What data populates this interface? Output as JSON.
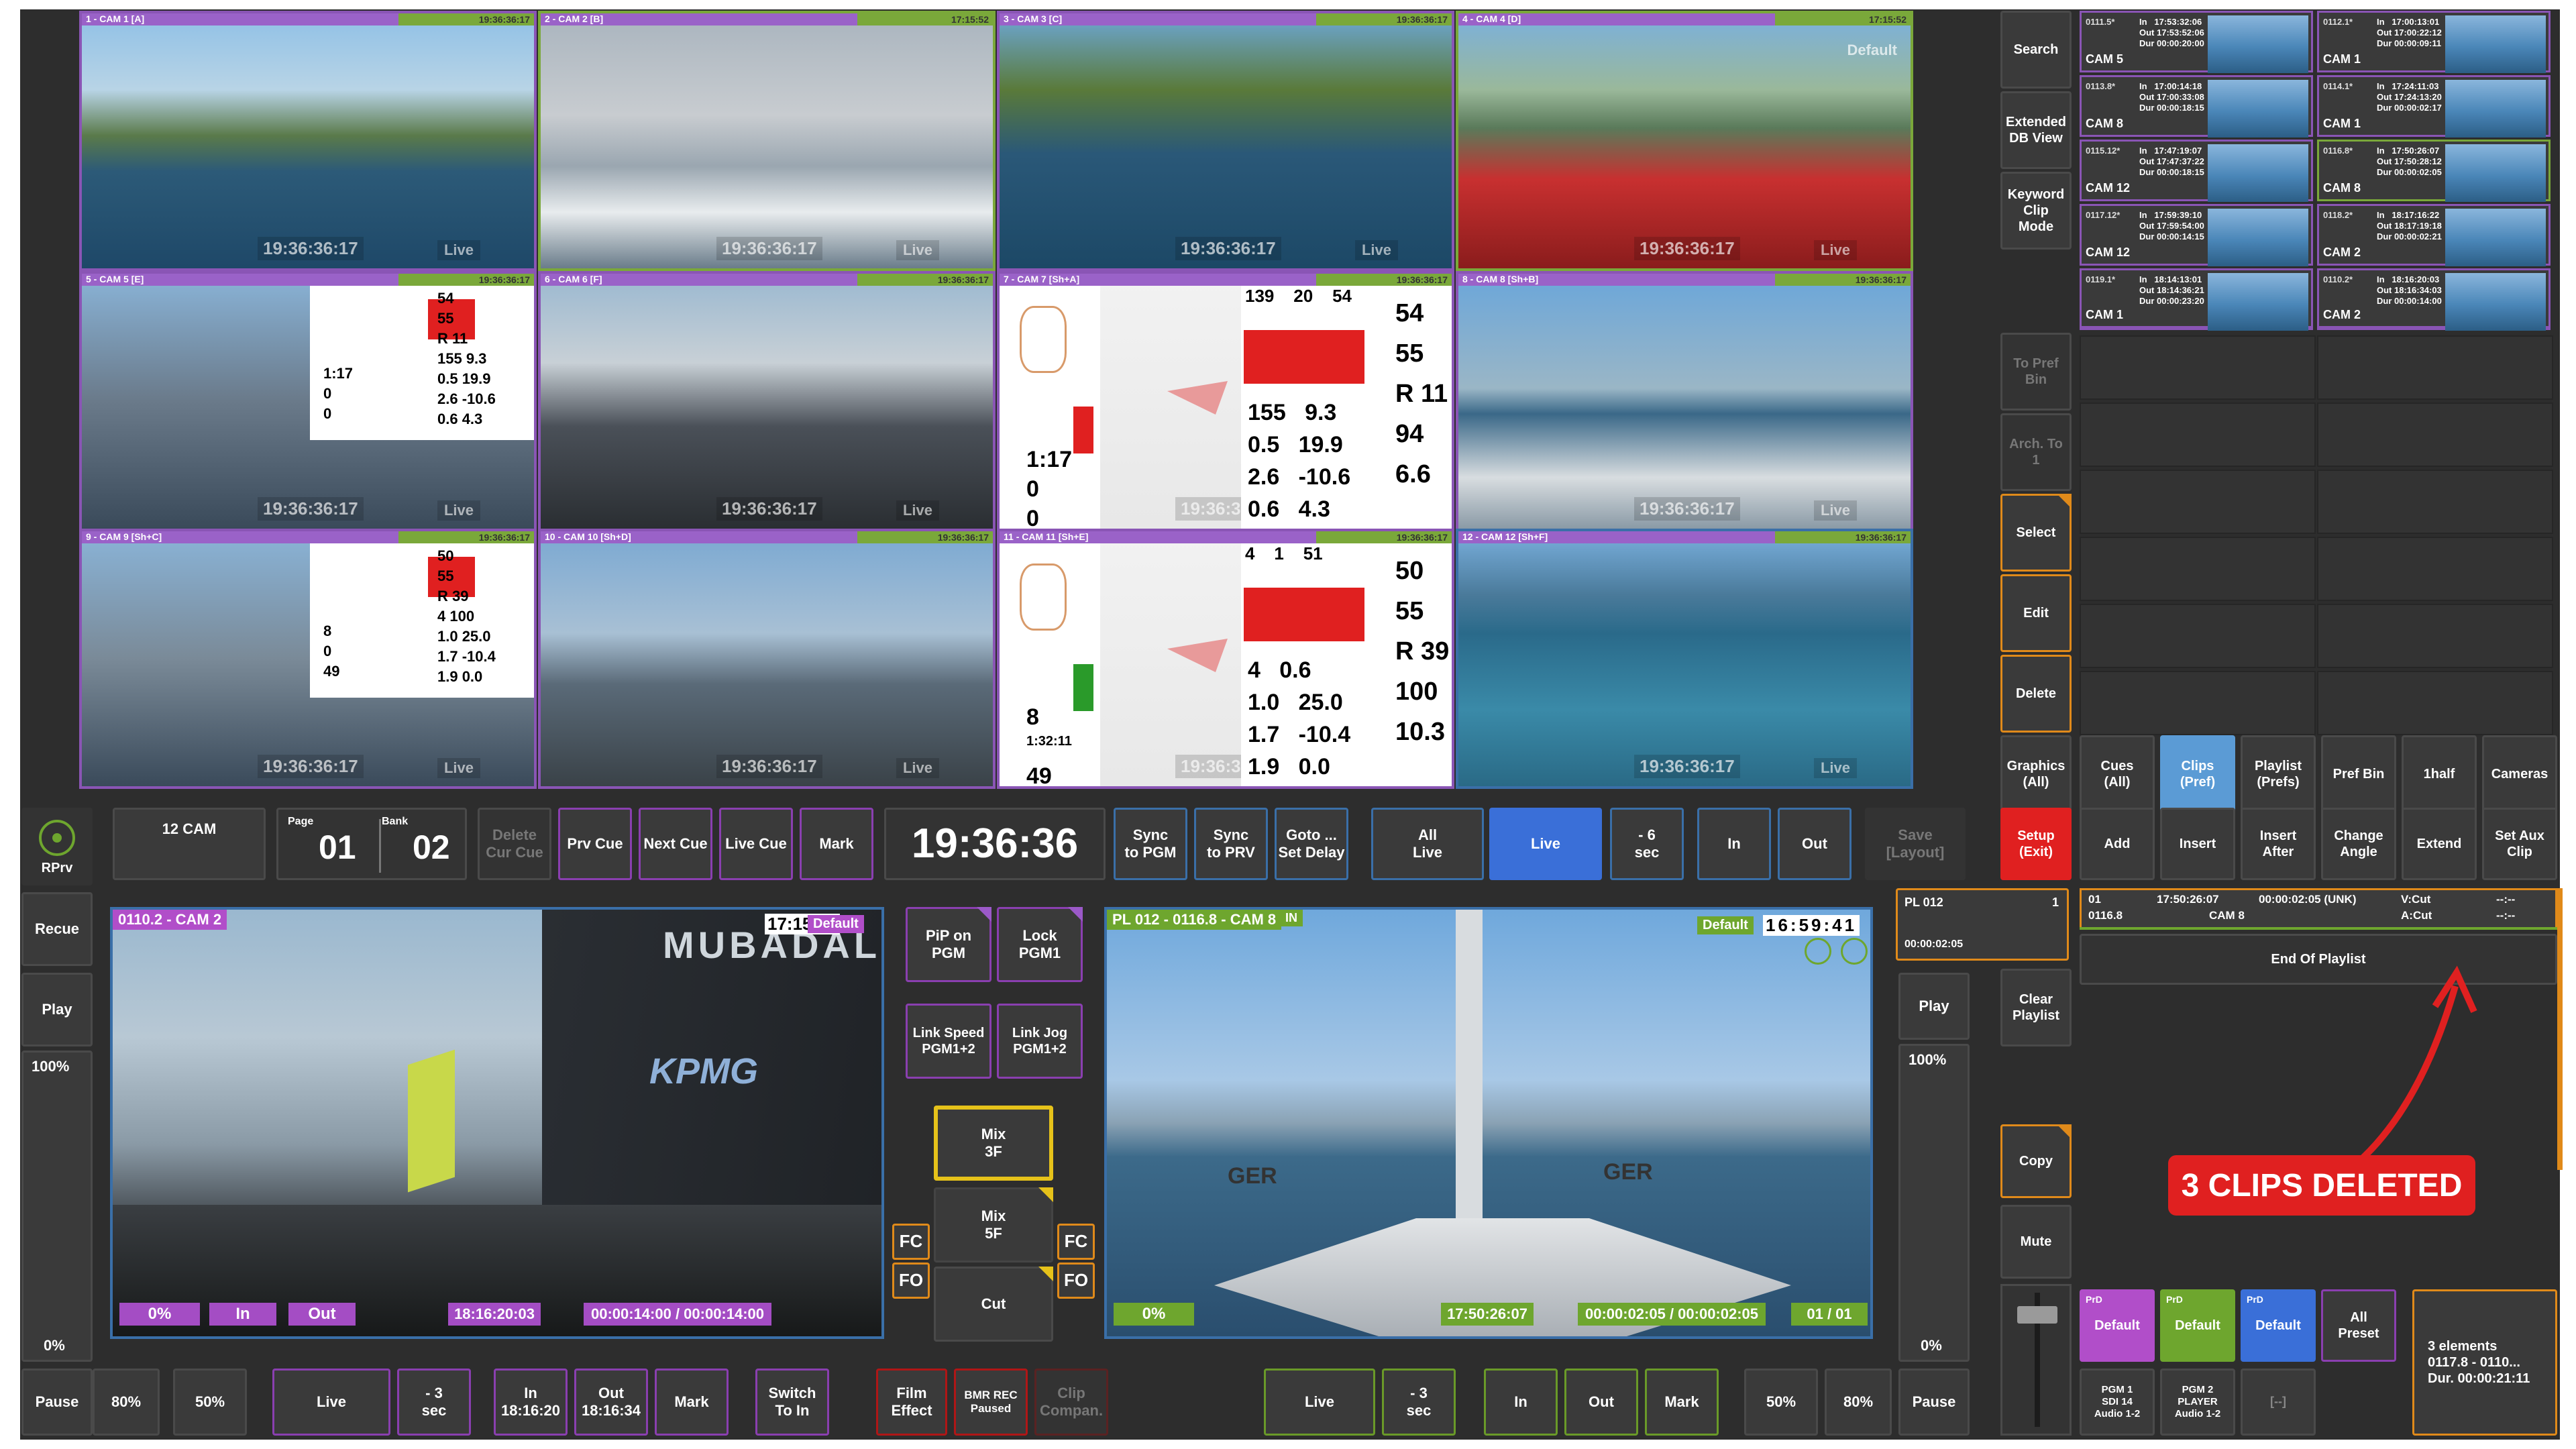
{
  "tiles": [
    {
      "label": "1 - CAM 1 [A]",
      "tc": "19:36:36:17",
      "time": "19:36:36:17",
      "live": "Live",
      "default": ""
    },
    {
      "label": "2 - CAM 2 [B]",
      "tc": "17:15:52",
      "time": "19:36:36:17",
      "live": "Live",
      "default": ""
    },
    {
      "label": "3 - CAM 3 [C]",
      "tc": "19:36:36:17",
      "time": "19:36:36:17",
      "live": "Live",
      "default": ""
    },
    {
      "label": "4 - CAM 4 [D]",
      "tc": "17:15:52",
      "time": "19:36:36:17",
      "live": "Live",
      "default": "Default"
    },
    {
      "label": "5 - CAM 5 [E]",
      "tc": "19:36:36:17",
      "time": "19:36:36:17",
      "live": "Live",
      "default": ""
    },
    {
      "label": "6 - CAM 6 [F]",
      "tc": "19:36:36:17",
      "time": "19:36:36:17",
      "live": "Live",
      "default": ""
    },
    {
      "label": "7 - CAM 7 [Sh+A]",
      "tc": "19:36:36:17",
      "time": "19:36:36:17",
      "live": "Live",
      "default": ""
    },
    {
      "label": "8 - CAM 8 [Sh+B]",
      "tc": "19:36:36:17",
      "time": "19:36:36:17",
      "live": "Live",
      "default": ""
    },
    {
      "label": "9 - CAM 9 [Sh+C]",
      "tc": "19:36:36:17",
      "time": "19:36:36:17",
      "live": "Live",
      "default": ""
    },
    {
      "label": "10 - CAM 10 [Sh+D]",
      "tc": "19:36:36:17",
      "time": "19:36:36:17",
      "live": "Live",
      "default": ""
    },
    {
      "label": "11 - CAM 11 [Sh+E]",
      "tc": "19:36:36:17",
      "time": "19:36:36:17",
      "live": "Live",
      "default": ""
    },
    {
      "label": "12 - CAM 12 [Sh+F]",
      "tc": "19:36:36:17",
      "time": "19:36:36:17",
      "live": "Live",
      "default": ""
    }
  ],
  "telemetry": {
    "tile7": {
      "top": [
        "139",
        "20",
        "54"
      ],
      "rows": [
        [
          "155",
          "9.3"
        ],
        [
          "0.5",
          "19.9"
        ],
        [
          "2.6",
          "-10.6"
        ],
        [
          "0.6",
          "4.3"
        ]
      ],
      "right": [
        "54",
        "55",
        "R 11",
        "94",
        "6.6"
      ],
      "left": [
        "1:17",
        "0",
        "0"
      ]
    },
    "tile11": {
      "top": [
        "4",
        "1",
        "51"
      ],
      "rows": [
        [
          "4",
          "0.6"
        ],
        [
          "1.0",
          "25.0"
        ],
        [
          "1.7",
          "-10.4"
        ],
        [
          "1.9",
          "0.0"
        ]
      ],
      "right": [
        "50",
        "55",
        "R 39",
        "100",
        "10.3"
      ],
      "left": [
        "8",
        "1:32:11",
        "49"
      ]
    },
    "tile5": {
      "rows": [
        "54",
        "55",
        "R 11",
        "155 9.3",
        "0.5 19.9",
        "2.6 -10.6",
        "0.6 4.3"
      ],
      "left": [
        "1:17",
        "0",
        "0"
      ]
    },
    "tile9": {
      "rows": [
        "50",
        "55",
        "R 39",
        "4 100",
        "1.0 25.0",
        "1.7 -10.4",
        "1.9 0.0"
      ],
      "left": [
        "8",
        "0",
        "49"
      ]
    }
  },
  "side_buttons": {
    "search": "Search",
    "extended": "Extended\nDB View",
    "keyword": "Keyword\nClip\nMode",
    "to_pref_bin": "To Pref\nBin",
    "arch_to": "Arch. To\n1",
    "select": "Select",
    "edit": "Edit",
    "delete": "Delete",
    "graphics": "Graphics\n(All)"
  },
  "clips": [
    {
      "id": "0111.5*",
      "in": "17:53:32:06",
      "out": "17:53:52:06",
      "dur": "00:00:20:00",
      "cam": "CAM 5"
    },
    {
      "id": "0112.1*",
      "in": "17:00:13:01",
      "out": "17:00:22:12",
      "dur": "00:00:09:11",
      "cam": "CAM 1"
    },
    {
      "id": "0113.8*",
      "in": "17:00:14:18",
      "out": "17:00:33:08",
      "dur": "00:00:18:15",
      "cam": "CAM 8"
    },
    {
      "id": "0114.1*",
      "in": "17:24:11:03",
      "out": "17:24:13:20",
      "dur": "00:00:02:17",
      "cam": "CAM 1"
    },
    {
      "id": "0115.12*",
      "in": "17:47:19:07",
      "out": "17:47:37:22",
      "dur": "00:00:18:15",
      "cam": "CAM 12"
    },
    {
      "id": "0116.8*",
      "in": "17:50:26:07",
      "out": "17:50:28:12",
      "dur": "00:00:02:05",
      "cam": "CAM 8"
    },
    {
      "id": "0117.12*",
      "in": "17:59:39:10",
      "out": "17:59:54:00",
      "dur": "00:00:14:15",
      "cam": "CAM 12"
    },
    {
      "id": "0118.2*",
      "in": "18:17:16:22",
      "out": "18:17:19:18",
      "dur": "00:00:02:21",
      "cam": "CAM 2"
    },
    {
      "id": "0119.1*",
      "in": "18:14:13:01",
      "out": "18:14:36:21",
      "dur": "00:00:23:20",
      "cam": "CAM 1"
    },
    {
      "id": "0110.2*",
      "in": "18:16:20:03",
      "out": "18:16:34:03",
      "dur": "00:00:14:00",
      "cam": "CAM 2"
    }
  ],
  "clip_labels": {
    "in": "In",
    "out": "Out",
    "dur": "Dur"
  },
  "tabs": {
    "cues": "Cues\n(All)",
    "clips": "Clips\n(Pref)",
    "playlist": "Playlist\n(Prefs)",
    "pref_bin": "Pref Bin",
    "half": "1half",
    "cameras": "Cameras"
  },
  "controls": {
    "rprv": "RPrv",
    "cam12": "12 CAM",
    "page_label": "Page",
    "page": "01",
    "bank_label": "Bank",
    "bank": "02",
    "delete_cue": "Delete\nCur Cue",
    "prv_cue": "Prv Cue",
    "next_cue": "Next Cue",
    "live_cue": "Live Cue",
    "mark": "Mark",
    "clock": "19:36:36",
    "sync_pgm": "Sync\nto PGM",
    "sync_prv": "Sync\nto PRV",
    "goto": "Goto ...\nSet Delay",
    "all_live": "All\nLive",
    "live": "Live",
    "minus6": "- 6\nsec",
    "in": "In",
    "out": "Out",
    "save_layout": "Save\n[Layout]",
    "setup": "Setup\n(Exit)",
    "add": "Add",
    "insert": "Insert",
    "insert_after": "Insert\nAfter",
    "change_angle": "Change\nAngle",
    "extend": "Extend",
    "set_aux": "Set Aux\nClip"
  },
  "left_monitor": {
    "title": "0110.2 - CAM 2",
    "tc": "17:15:52",
    "default": "Default",
    "pct": "0%",
    "in": "In",
    "out": "Out",
    "time": "18:16:20:03",
    "range": "00:00:14:00 / 00:00:14:00",
    "watermark": "MUBADALA",
    "kpmg": "KPMG"
  },
  "right_monitor": {
    "title": "PL 012 - 0116.8 - CAM 8",
    "in_tag": "IN",
    "tc": "16:59:41",
    "default": "Default",
    "pct": "0%",
    "time": "17:50:26:07",
    "range": "00:00:02:05 / 00:00:02:05",
    "count": "01 / 01",
    "sail1": "GER",
    "sail2": "GER"
  },
  "left_rail": {
    "recue": "Recue",
    "play": "Play",
    "pct_top": "100%",
    "pct_bottom": "0%",
    "pause": "Pause"
  },
  "center": {
    "pip": "PiP on\nPGM",
    "lock": "Lock\nPGM1",
    "link_speed": "Link Speed\nPGM1+2",
    "link_jog": "Link Jog\nPGM1+2",
    "mix3": "Mix\n3F",
    "mix5": "Mix\n5F",
    "cut": "Cut",
    "fc": "FC",
    "fo": "FO"
  },
  "playlist": {
    "name": "PL 012",
    "num": "1",
    "dur": "00:00:02:05",
    "row_idx": "01",
    "row_in": "17:50:26:07",
    "row_dur": "00:00:02:05 (UNK)",
    "row_clip": "0116.8",
    "row_cam": "CAM 8",
    "vcut": "V:Cut",
    "acut": "A:Cut",
    "dash1": "--:--",
    "dash2": "--:--",
    "end": "End Of Playlist",
    "clear": "Clear\nPlaylist",
    "play": "Play",
    "pct_top": "100%",
    "pct_bottom": "0%",
    "copy": "Copy",
    "mute": "Mute"
  },
  "annotation": "3 CLIPS DELETED",
  "presets": {
    "p1": "Default",
    "p2": "Default",
    "p3": "Default",
    "all": "All\nPreset",
    "prd": "PrD",
    "info": "3 elements\n0117.8 - 0110...\nDur. 00:00:21:11",
    "out1": "PGM 1\nSDI 14\nAudio 1-2",
    "out2": "PGM 2\nPLAYER\nAudio 1-2",
    "out3": "[--]"
  },
  "bottom": {
    "pause": "Pause",
    "p80": "80%",
    "p50": "50%",
    "live": "Live",
    "minus3": "- 3\nsec",
    "in": "In\n18:16:20",
    "out": "Out\n18:16:34",
    "mark": "Mark",
    "switch": "Switch\nTo In",
    "film": "Film\nEffect",
    "bmr": "BMR REC\nPaused",
    "clip_comp": "Clip\nCompan.",
    "r_live": "Live",
    "r_minus3": "- 3\nsec",
    "r_in": "In",
    "r_out": "Out",
    "r_mark": "Mark",
    "r_p50": "50%",
    "r_p80": "80%",
    "r_pause": "Pause"
  },
  "colors": {
    "accent_blue": "#3a6fd8",
    "clips_tab": "#5b9bd5",
    "setup_red": "#e02020",
    "preset_purple": "#b14ec9",
    "preset_green": "#6ea62e",
    "preset_blue": "#3a6fd8",
    "annotation_red": "#e02020"
  }
}
